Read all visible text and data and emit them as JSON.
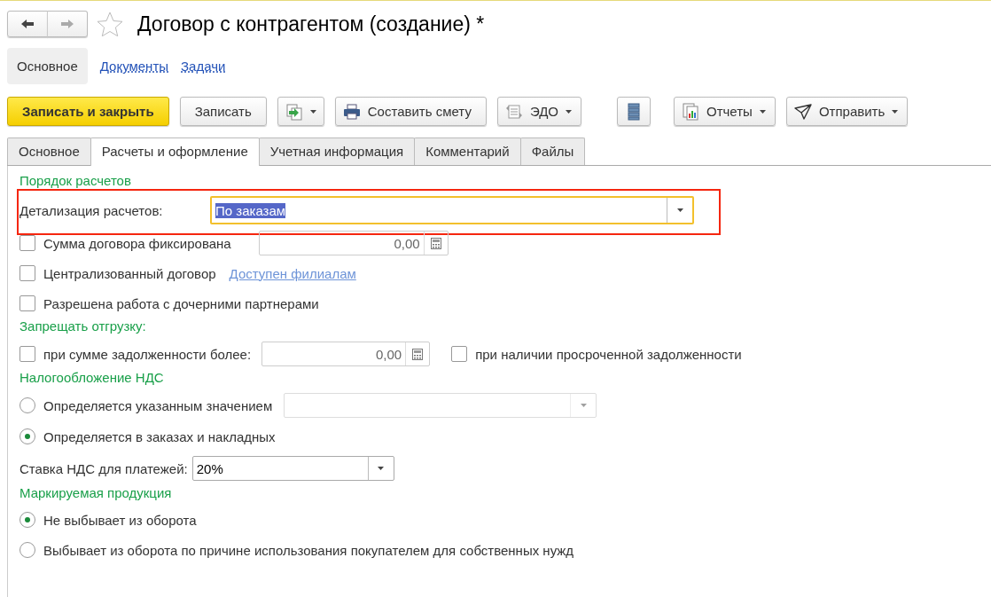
{
  "window": {
    "title": "Договор с контрагентом (создание) *"
  },
  "sections": [
    {
      "label": "Основное",
      "selected": true
    },
    {
      "label": "Документы",
      "selected": false
    },
    {
      "label": "Задачи",
      "selected": false
    }
  ],
  "toolbar": [
    {
      "kind": "primary",
      "label": "Записать и закрыть"
    },
    {
      "kind": "text",
      "label": "Записать"
    },
    {
      "kind": "menu-icon"
    },
    {
      "kind": "icon-text",
      "label": "Составить смету"
    },
    {
      "kind": "icon-menu",
      "label": "ЭДО"
    },
    {
      "kind": "icon"
    },
    {
      "kind": "icon-menu",
      "label": "Отчеты"
    },
    {
      "kind": "icon-menu",
      "label": "Отправить"
    }
  ],
  "tabs": [
    {
      "label": "Основное",
      "selected": false
    },
    {
      "label": "Расчеты и оформление",
      "selected": true
    },
    {
      "label": "Учетная информация",
      "selected": false
    },
    {
      "label": "Комментарий",
      "selected": false
    },
    {
      "label": "Файлы",
      "selected": false
    }
  ],
  "form": [
    {
      "kind": "group",
      "title": "Порядок расчетов"
    },
    {
      "kind": "select",
      "label": "Детализация расчетов:",
      "value": "По заказам",
      "focused": true,
      "highlighted": true
    },
    {
      "kind": "checkbox-number",
      "label": "Сумма договора фиксирована",
      "checked": false,
      "value": "0,00"
    },
    {
      "kind": "checkbox-link",
      "label": "Централизованный договор",
      "checked": false,
      "link": "Доступен филиалам"
    },
    {
      "kind": "checkbox",
      "label": "Разрешена работа с дочерними партнерами",
      "checked": false
    },
    {
      "kind": "group",
      "title": "Запрещать отгрузку:"
    },
    {
      "kind": "checkbox-number-checkbox",
      "label": "при сумме задолженности более:",
      "checked": false,
      "value": "0,00",
      "label_2": "при наличии просроченной задолженности",
      "checked_2": false
    },
    {
      "kind": "group",
      "title": "Налогообложение НДС"
    },
    {
      "kind": "radio-select",
      "label": "Определяется указанным значением",
      "selected": false,
      "disabled": true
    },
    {
      "kind": "radio",
      "label": "Определяется в заказах и накладных",
      "selected": true
    },
    {
      "kind": "select-small",
      "label": "Ставка НДС для платежей:",
      "value": "20%"
    },
    {
      "kind": "group",
      "title": "Маркируемая продукция"
    },
    {
      "kind": "radio",
      "label": "Не выбывает из оборота",
      "selected": true
    },
    {
      "kind": "radio",
      "label": "Выбывает из оборота по причине использования покупателем для собственных нужд",
      "selected": false
    }
  ]
}
